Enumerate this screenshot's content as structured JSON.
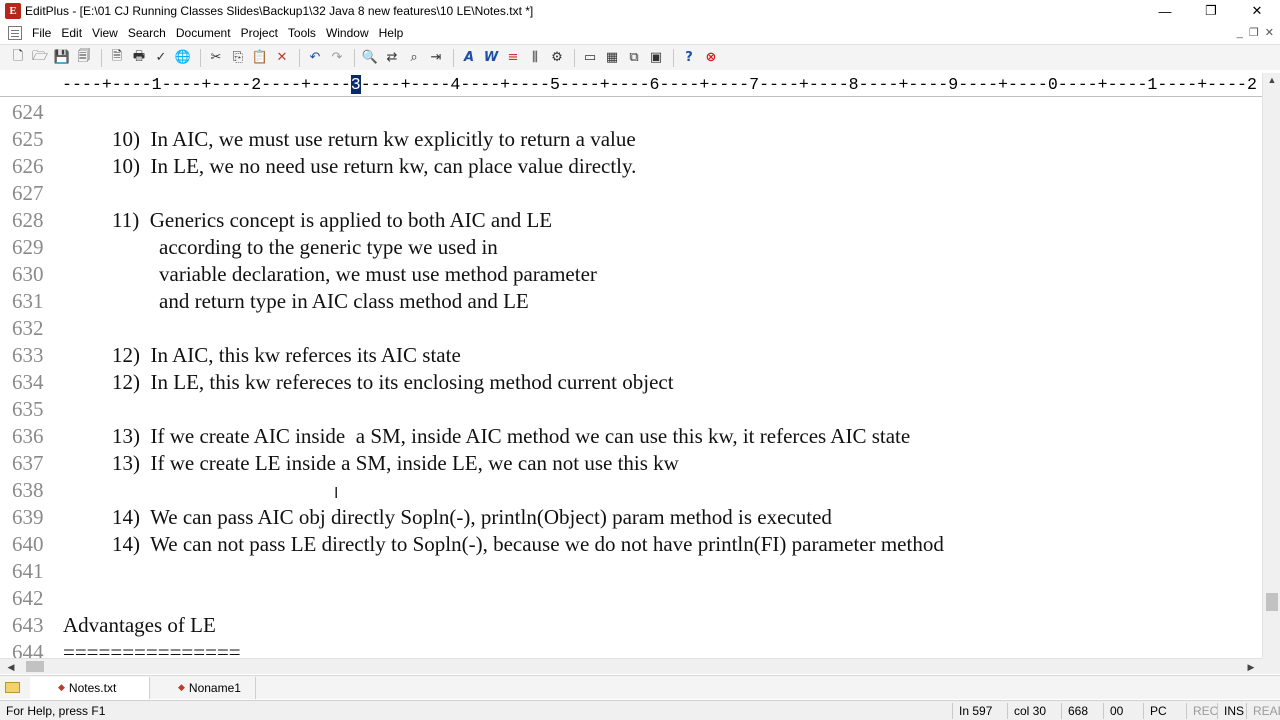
{
  "window": {
    "title": "EditPlus - [E:\\01 CJ Running Classes Slides\\Backup1\\32 Java 8 new features\\10 LE\\Notes.txt *]",
    "app_icon_letter": "E",
    "minimize": "—",
    "maximize": "❐",
    "close": "✕"
  },
  "menu": {
    "items": [
      "File",
      "Edit",
      "View",
      "Search",
      "Document",
      "Project",
      "Tools",
      "Window",
      "Help"
    ],
    "mdi_controls": [
      "_",
      "❐",
      "✕"
    ]
  },
  "toolbar": {
    "icons": [
      "new-file-icon",
      "open-icon",
      "save-icon",
      "save-all-icon",
      "print-preview-icon",
      "print-icon",
      "spellcheck-icon",
      "browser-icon",
      "cut-icon",
      "copy-icon",
      "paste-icon",
      "delete-icon",
      "undo-icon",
      "redo-icon",
      "find-icon",
      "replace-icon",
      "find-in-files-icon",
      "goto-icon",
      "font-icon",
      "word-wrap-icon",
      "ruler-icon",
      "column-icon",
      "settings-icon",
      "window-icon",
      "tile-icon",
      "cascade-icon",
      "full-screen-icon",
      "help-icon",
      "stop-icon"
    ],
    "glyphs": [
      "🗋",
      "🗁",
      "💾",
      "🗐",
      "🗎",
      "🖶",
      "✓",
      "🌐",
      "✂",
      "⎘",
      "📋",
      "✕",
      "↶",
      "↷",
      "🔍",
      "⇄",
      "⌕",
      "⇥",
      "A",
      "W",
      "≡",
      "⫼",
      "⚙",
      "▭",
      "▦",
      "⧉",
      "▣",
      "?",
      "⊗"
    ]
  },
  "ruler": {
    "before": "----+----1----+----2----+----",
    "current": "3",
    "after": "----+----4----+----5----+----6----+----7----+----8----+----9----+----0----+----1----+----2"
  },
  "editor": {
    "lines": [
      {
        "num": "624",
        "indent": "",
        "text": ""
      },
      {
        "num": "625",
        "indent": "    ",
        "text": "10)  In AIC, we must use return kw explicitly to return a value"
      },
      {
        "num": "626",
        "indent": "    ",
        "text": "10)  In LE, we no need use return kw, can place value directly."
      },
      {
        "num": "627",
        "indent": "",
        "text": ""
      },
      {
        "num": "628",
        "indent": "    ",
        "text": "11)  Generics concept is applied to both AIC and LE"
      },
      {
        "num": "629",
        "indent": "         ",
        "text": "according to the generic type we used in"
      },
      {
        "num": "630",
        "indent": "         ",
        "text": "variable declaration, we must use method parameter"
      },
      {
        "num": "631",
        "indent": "         ",
        "text": "and return type in AIC class method and LE"
      },
      {
        "num": "632",
        "indent": "",
        "text": ""
      },
      {
        "num": "633",
        "indent": "    ",
        "text": "12)  In AIC, this kw referces its AIC state"
      },
      {
        "num": "634",
        "indent": "    ",
        "text": "12)  In LE, this kw refereces to its enclosing method current object"
      },
      {
        "num": "635",
        "indent": "",
        "text": ""
      },
      {
        "num": "636",
        "indent": "    ",
        "text": "13)  If we create AIC inside  a SM, inside AIC method we can use this kw, it referces AIC state"
      },
      {
        "num": "637",
        "indent": "    ",
        "text": "13)  If we create LE inside a SM, inside LE, we can not use this kw"
      },
      {
        "num": "638",
        "indent": "",
        "text": ""
      },
      {
        "num": "639",
        "indent": "    ",
        "text": "14)  We can pass AIC obj directly Sopln(-), println(Object) param method is executed"
      },
      {
        "num": "640",
        "indent": "    ",
        "text": "14)  We can not pass LE directly to Sopln(-), because we do not have println(FI) parameter method"
      },
      {
        "num": "641",
        "indent": "",
        "text": ""
      },
      {
        "num": "642",
        "indent": "",
        "text": ""
      },
      {
        "num": "643",
        "indent": "",
        "text": "Advantages of LE"
      },
      {
        "num": "644",
        "indent": "",
        "text": "==============="
      }
    ]
  },
  "tabs": [
    {
      "label": "Notes.txt",
      "active": true
    },
    {
      "label": "Noname1",
      "active": false
    }
  ],
  "status": {
    "help": "For Help, press F1",
    "line": "In 597",
    "col": "col 30",
    "count": "668",
    "extra": "00",
    "eol": "PC",
    "rec": "REC",
    "ins": "INS",
    "read": "READ"
  }
}
